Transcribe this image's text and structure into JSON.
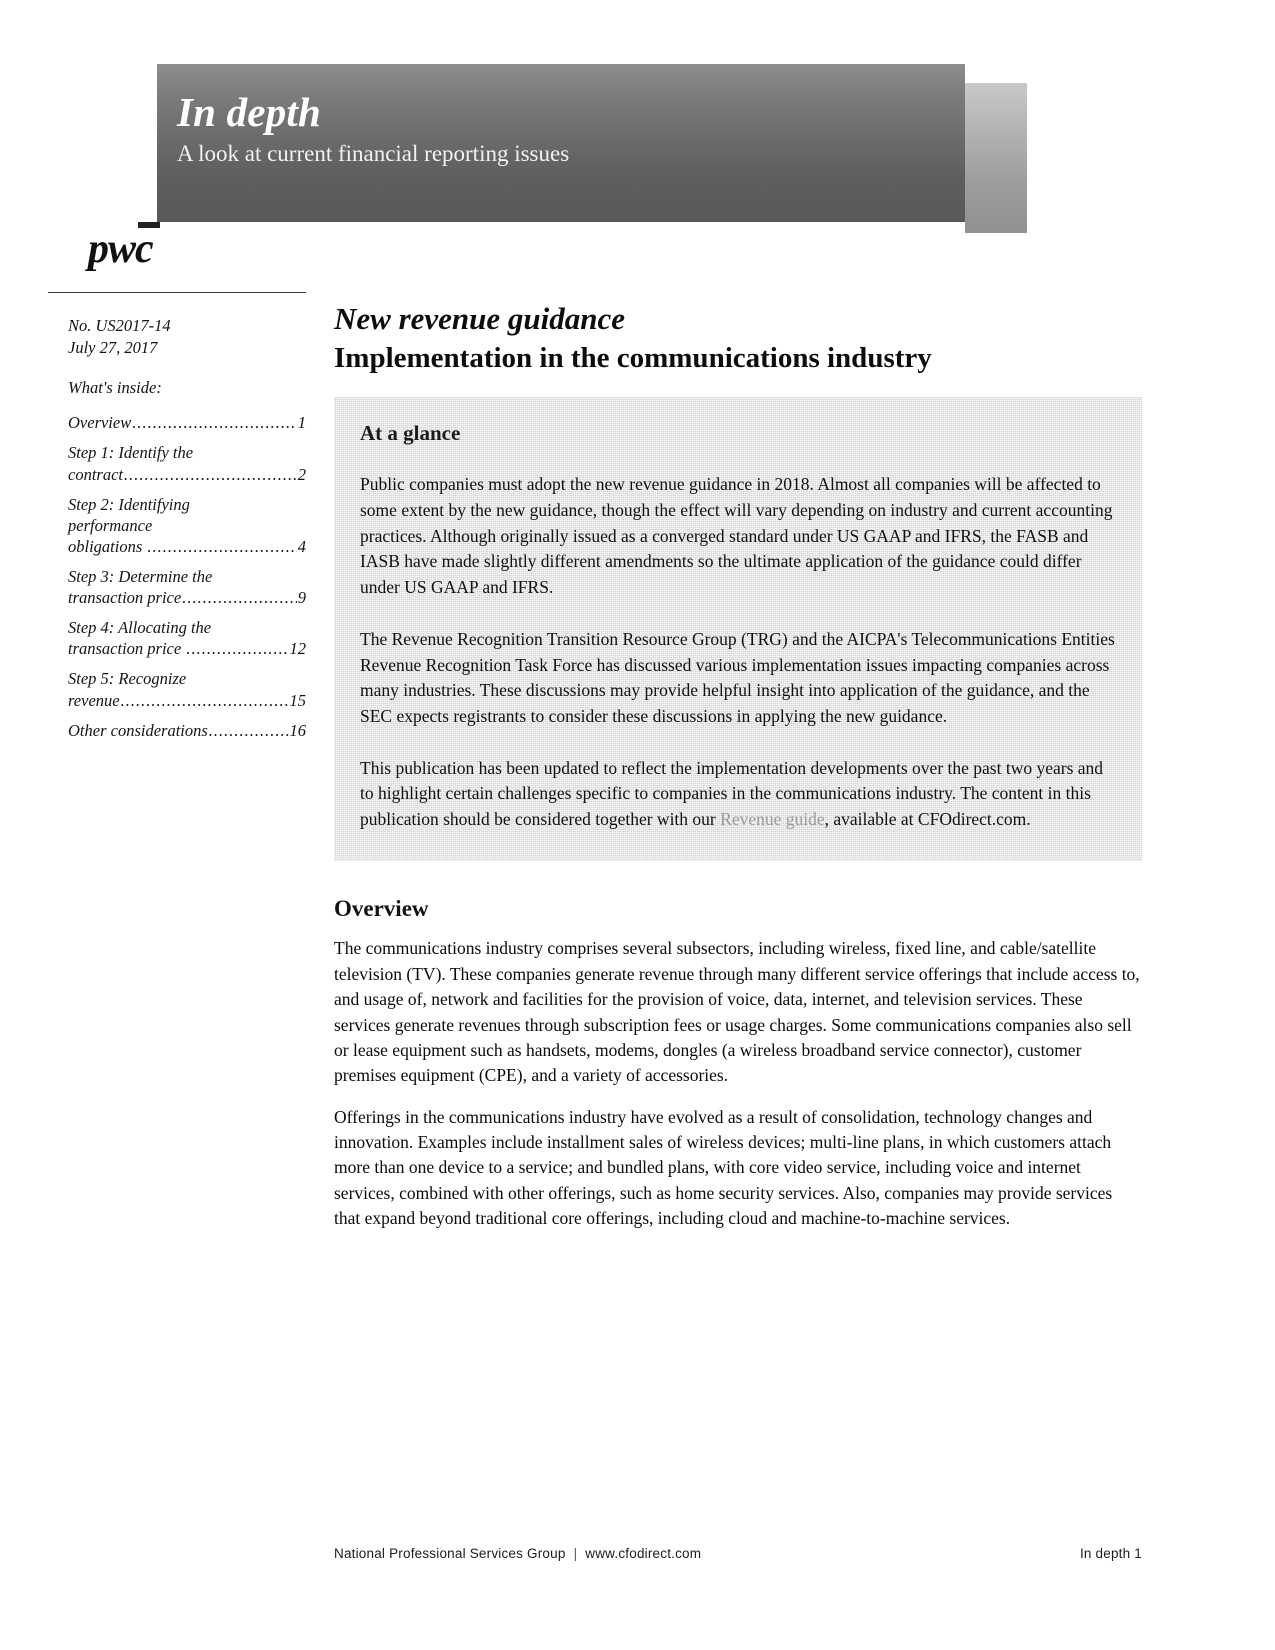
{
  "masthead": {
    "title": "In depth",
    "subtitle": "A look at current financial reporting issues"
  },
  "logo": {
    "wordmark": "pwc"
  },
  "sidebar": {
    "publication_number": "No. US2017-14",
    "publication_date": "July 27, 2017",
    "whats_inside_label": "What's inside:",
    "toc": [
      {
        "label": "Overview",
        "page": "1",
        "wrap": ""
      },
      {
        "label": "contract",
        "page": "2",
        "wrap": "Step 1: Identify the"
      },
      {
        "label": "obligations ",
        "page": "4",
        "wrap": "Step 2: Identifying\nperformance"
      },
      {
        "label": "transaction price",
        "page": "9",
        "wrap": "Step 3: Determine the"
      },
      {
        "label": "transaction price ",
        "page": "12",
        "wrap": "Step 4: Allocating the"
      },
      {
        "label": "revenue",
        "page": "15",
        "wrap": "Step 5: Recognize"
      },
      {
        "label": "Other considerations",
        "page": "16",
        "wrap": ""
      }
    ]
  },
  "document": {
    "title": "New revenue guidance",
    "subtitle": "Implementation in the communications industry"
  },
  "at_a_glance": {
    "heading": "At a glance",
    "paragraphs": [
      "Public companies must adopt the new revenue guidance in 2018. Almost all companies will be affected to some extent by the new guidance, though the effect will vary depending on industry and current accounting practices. Although originally issued as a converged standard under US GAAP and IFRS, the FASB and IASB have made slightly different amendments so the ultimate application of the guidance could differ under US GAAP and IFRS.",
      "The Revenue Recognition Transition Resource Group (TRG) and the AICPA's Telecommunications Entities Revenue Recognition Task Force has discussed various implementation issues impacting companies across many industries. These discussions may provide helpful insight into application of the guidance, and the SEC expects registrants to consider these discussions in applying the new guidance."
    ],
    "last_paragraph_before_link": "This publication has been updated to reflect the implementation developments over the past two years and to highlight certain challenges specific to companies in the communications industry. The content in this publication should be considered together with our ",
    "link_text": "Revenue guide",
    "last_paragraph_after_link": ", available at CFOdirect.com."
  },
  "overview": {
    "heading": "Overview",
    "paragraphs": [
      "The communications industry comprises several subsectors, including wireless, fixed line, and cable/satellite television (TV). These companies generate revenue through many different service offerings that include access to, and usage of, network and facilities for the provision of voice, data, internet, and television services. These services generate revenues through subscription fees or usage charges. Some communications companies also sell or lease equipment such as handsets, modems, dongles (a wireless broadband service connector), customer premises equipment (CPE), and a variety of accessories.",
      "Offerings in the communications industry have evolved as a result of consolidation, technology changes and innovation. Examples include installment sales of wireless devices; multi-line plans, in which customers attach more than one device to a service; and bundled plans, with core video service, including voice and internet services, combined with other offerings, such as home security services. Also, companies may provide services that expand beyond traditional core offerings, including cloud and machine-to-machine services."
    ]
  },
  "footer": {
    "group": "National Professional Services Group",
    "separator": "|",
    "website": "www.cfodirect.com",
    "page_label": "In depth 1"
  },
  "colors": {
    "masthead_dark": "#5f5f5f",
    "glance_background": "#d6d6d6",
    "link_gray": "#9a9a9a",
    "text": "#0d0d0d"
  }
}
